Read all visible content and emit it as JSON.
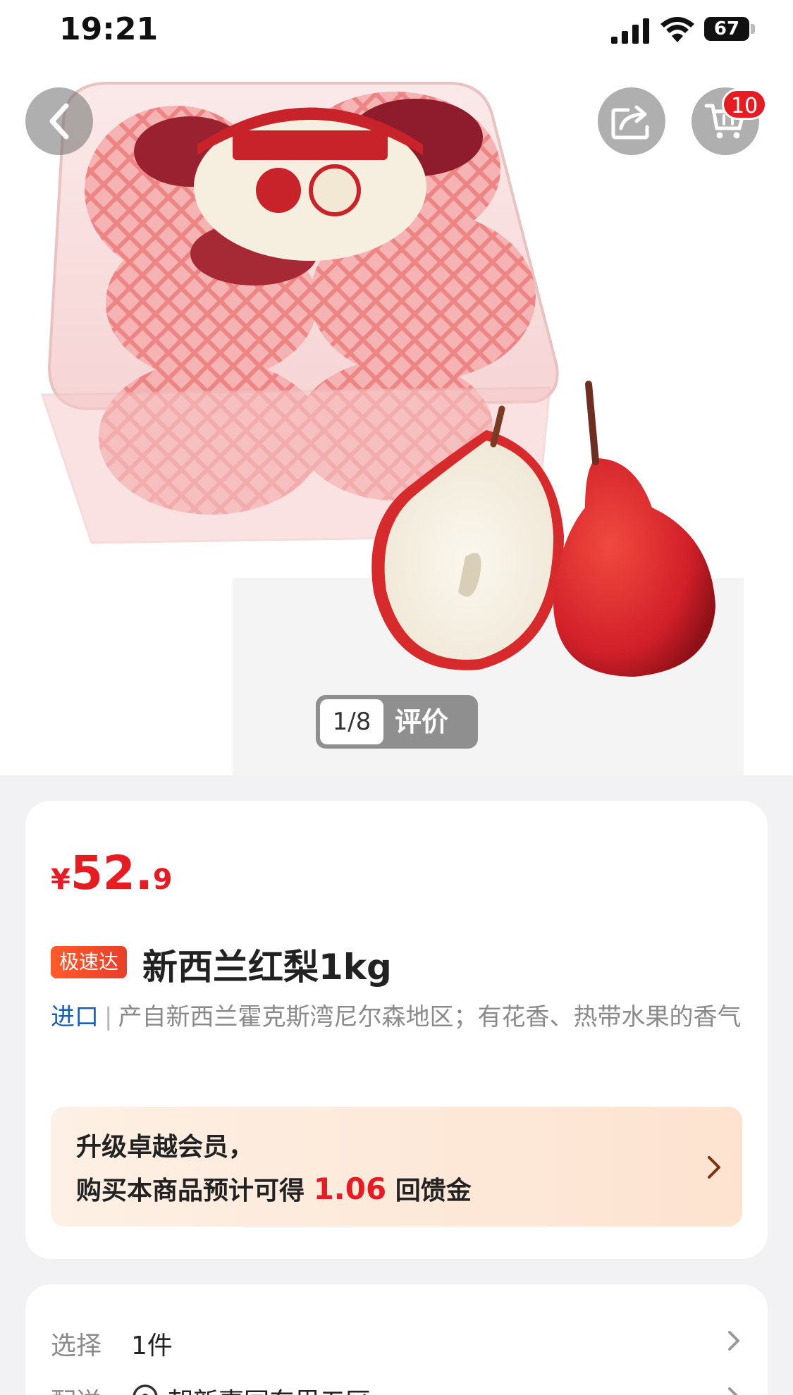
{
  "status_bar": {
    "time": "19:21",
    "battery": "67",
    "icons": [
      "signal-icon",
      "wifi-icon",
      "battery-icon"
    ]
  },
  "nav": {
    "back_icon": "chevron-left-icon",
    "share_icon": "share-icon",
    "cart_icon": "cart-icon",
    "cart_badge": "10"
  },
  "hero": {
    "product_image": "red-pear-box-photo",
    "pager_index": "1/8",
    "pager_review": "评价"
  },
  "product": {
    "price_symbol": "¥",
    "price_integer": "52.",
    "price_decimal": "9",
    "speed_tag": "极速达",
    "title": "新西兰红梨1kg",
    "import_tag": "进口",
    "separator": "|",
    "description": "产自新西兰霍克斯湾尼尔森地区；有花香、热带水果的香气"
  },
  "member": {
    "line1": "升级卓越会员，",
    "line2_prefix": "购买本商品预计可得",
    "amount": "1.06",
    "line2_suffix": "回馈金"
  },
  "options": {
    "select_label": "选择",
    "select_value": "1件",
    "delivery_label": "配送",
    "delivery_value": "朝新嘉园东里五区"
  },
  "colors": {
    "price_red": "#e51c23",
    "import_blue": "#1a5fb4",
    "background": "#f2f2f4"
  }
}
